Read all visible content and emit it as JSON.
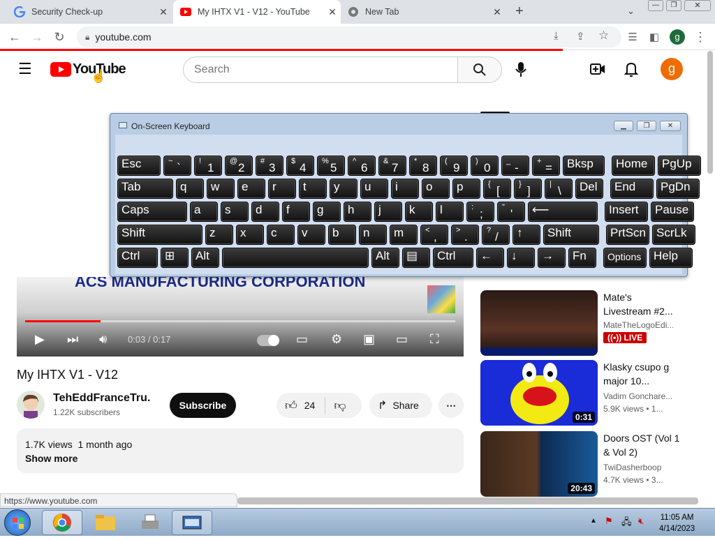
{
  "browser": {
    "tabs": [
      {
        "title": "Security Check-up",
        "icon": "google-g-icon",
        "active": false
      },
      {
        "title": "My IHTX V1 - V12 - YouTube",
        "icon": "youtube-icon",
        "active": true
      },
      {
        "title": "New Tab",
        "icon": "chrome-icon",
        "active": false
      }
    ],
    "url": "youtube.com",
    "profile_initial": "g"
  },
  "youtube": {
    "logo_text": "YouTube",
    "search_placeholder": "Search",
    "user_initial": "g",
    "accent": "#ff0000"
  },
  "osk": {
    "title": "On-Screen Keyboard",
    "rows": [
      [
        {
          "t": "Esc"
        },
        {
          "s": "~",
          "l": "`"
        },
        {
          "s": "!",
          "l": "1"
        },
        {
          "s": "@",
          "l": "2"
        },
        {
          "s": "#",
          "l": "3"
        },
        {
          "s": "$",
          "l": "4"
        },
        {
          "s": "%",
          "l": "5"
        },
        {
          "s": "^",
          "l": "6"
        },
        {
          "s": "&",
          "l": "7"
        },
        {
          "s": "*",
          "l": "8"
        },
        {
          "s": "(",
          "l": "9"
        },
        {
          "s": ")",
          "l": "0"
        },
        {
          "s": "_",
          "l": "-"
        },
        {
          "s": "+",
          "l": "="
        },
        {
          "t": "Bksp"
        },
        {
          "t": "Home"
        },
        {
          "t": "PgUp"
        }
      ],
      [
        {
          "t": "Tab"
        },
        {
          "t": "q"
        },
        {
          "t": "w"
        },
        {
          "t": "e"
        },
        {
          "t": "r"
        },
        {
          "t": "t"
        },
        {
          "t": "y"
        },
        {
          "t": "u"
        },
        {
          "t": "i"
        },
        {
          "t": "o"
        },
        {
          "t": "p"
        },
        {
          "s": "{",
          "l": "["
        },
        {
          "s": "}",
          "l": "]"
        },
        {
          "s": "|",
          "l": "\\"
        },
        {
          "t": "Del"
        },
        {
          "t": "End"
        },
        {
          "t": "PgDn"
        }
      ],
      [
        {
          "t": "Caps"
        },
        {
          "t": "a"
        },
        {
          "t": "s"
        },
        {
          "t": "d"
        },
        {
          "t": "f"
        },
        {
          "t": "g"
        },
        {
          "t": "h"
        },
        {
          "t": "j"
        },
        {
          "t": "k"
        },
        {
          "t": "l"
        },
        {
          "s": ":",
          "l": ";"
        },
        {
          "s": "\"",
          "l": "'"
        },
        {
          "t": "⟵"
        },
        {
          "t": "Insert"
        },
        {
          "t": "Pause"
        }
      ],
      [
        {
          "t": "Shift"
        },
        {
          "t": "z"
        },
        {
          "t": "x"
        },
        {
          "t": "c"
        },
        {
          "t": "v"
        },
        {
          "t": "b"
        },
        {
          "t": "n"
        },
        {
          "t": "m"
        },
        {
          "s": "<",
          "l": ","
        },
        {
          "s": ">",
          "l": "."
        },
        {
          "s": "?",
          "l": "/"
        },
        {
          "t": "↑"
        },
        {
          "t": "Shift"
        },
        {
          "t": "PrtScn"
        },
        {
          "t": "ScrLk"
        }
      ],
      [
        {
          "t": "Ctrl"
        },
        {
          "t": "⊞"
        },
        {
          "t": "Alt"
        },
        {
          "t": ""
        },
        {
          "t": "Alt"
        },
        {
          "t": "▤"
        },
        {
          "t": "Ctrl"
        },
        {
          "t": "←"
        },
        {
          "t": "↓"
        },
        {
          "t": "→"
        },
        {
          "t": "Fn"
        },
        {
          "t": "Options"
        },
        {
          "t": "Help"
        }
      ]
    ]
  },
  "player": {
    "overlay_text": "ACS MANUFACTURING CORPORATION",
    "time": "0:03 / 0:17",
    "progress": 0.176
  },
  "video": {
    "title": "My IHTX V1 - V12",
    "channel": "TehEddFranceTru...",
    "subscribers": "1.22K subscribers",
    "subscribe_label": "Subscribe",
    "likes": "24",
    "share_label": "Share",
    "views": "1.7K views",
    "age": "1 month ago",
    "show_more": "Show more"
  },
  "recommendations": [
    {
      "title": "Mate's Livestream #2...",
      "channel": "MateTheLogoEdi...",
      "meta": "LIVE",
      "duration": ""
    },
    {
      "title": "Klasky csupo g major 10...",
      "channel": "Vadim Goncharе...",
      "meta": "5.9K views • 1...",
      "duration": "0:31"
    },
    {
      "title": "Doors OST (Vol 1 & Vol 2)",
      "channel": "TwiDasherboop",
      "meta": "4.7K views • 3...",
      "duration": "20:43"
    }
  ],
  "status_url": "https://www.youtube.com",
  "taskbar": {
    "time": "11:05 AM",
    "date": "4/14/2023"
  }
}
